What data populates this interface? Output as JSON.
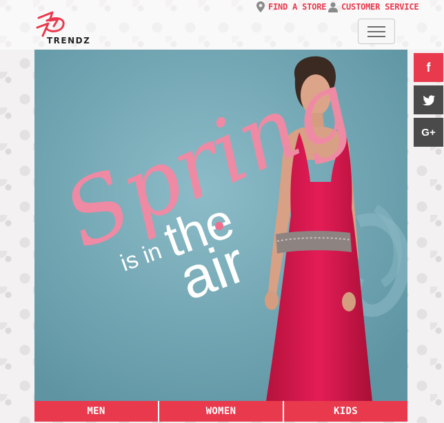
{
  "header": {
    "logo_text": "TRENDZ",
    "find_store": "FIND A STORE",
    "customer_service": "CUSTOMER SERVICE"
  },
  "hero": {
    "line1": "Spring",
    "line2": "is in",
    "line3": "the",
    "line4": "air"
  },
  "social": {
    "facebook": "f",
    "googleplus": "G+"
  },
  "nav": {
    "men": "MEN",
    "women": "WOMEN",
    "kids": "KIDS"
  },
  "colors": {
    "accent": "#e8394d",
    "dark": "#4a4a4a"
  }
}
